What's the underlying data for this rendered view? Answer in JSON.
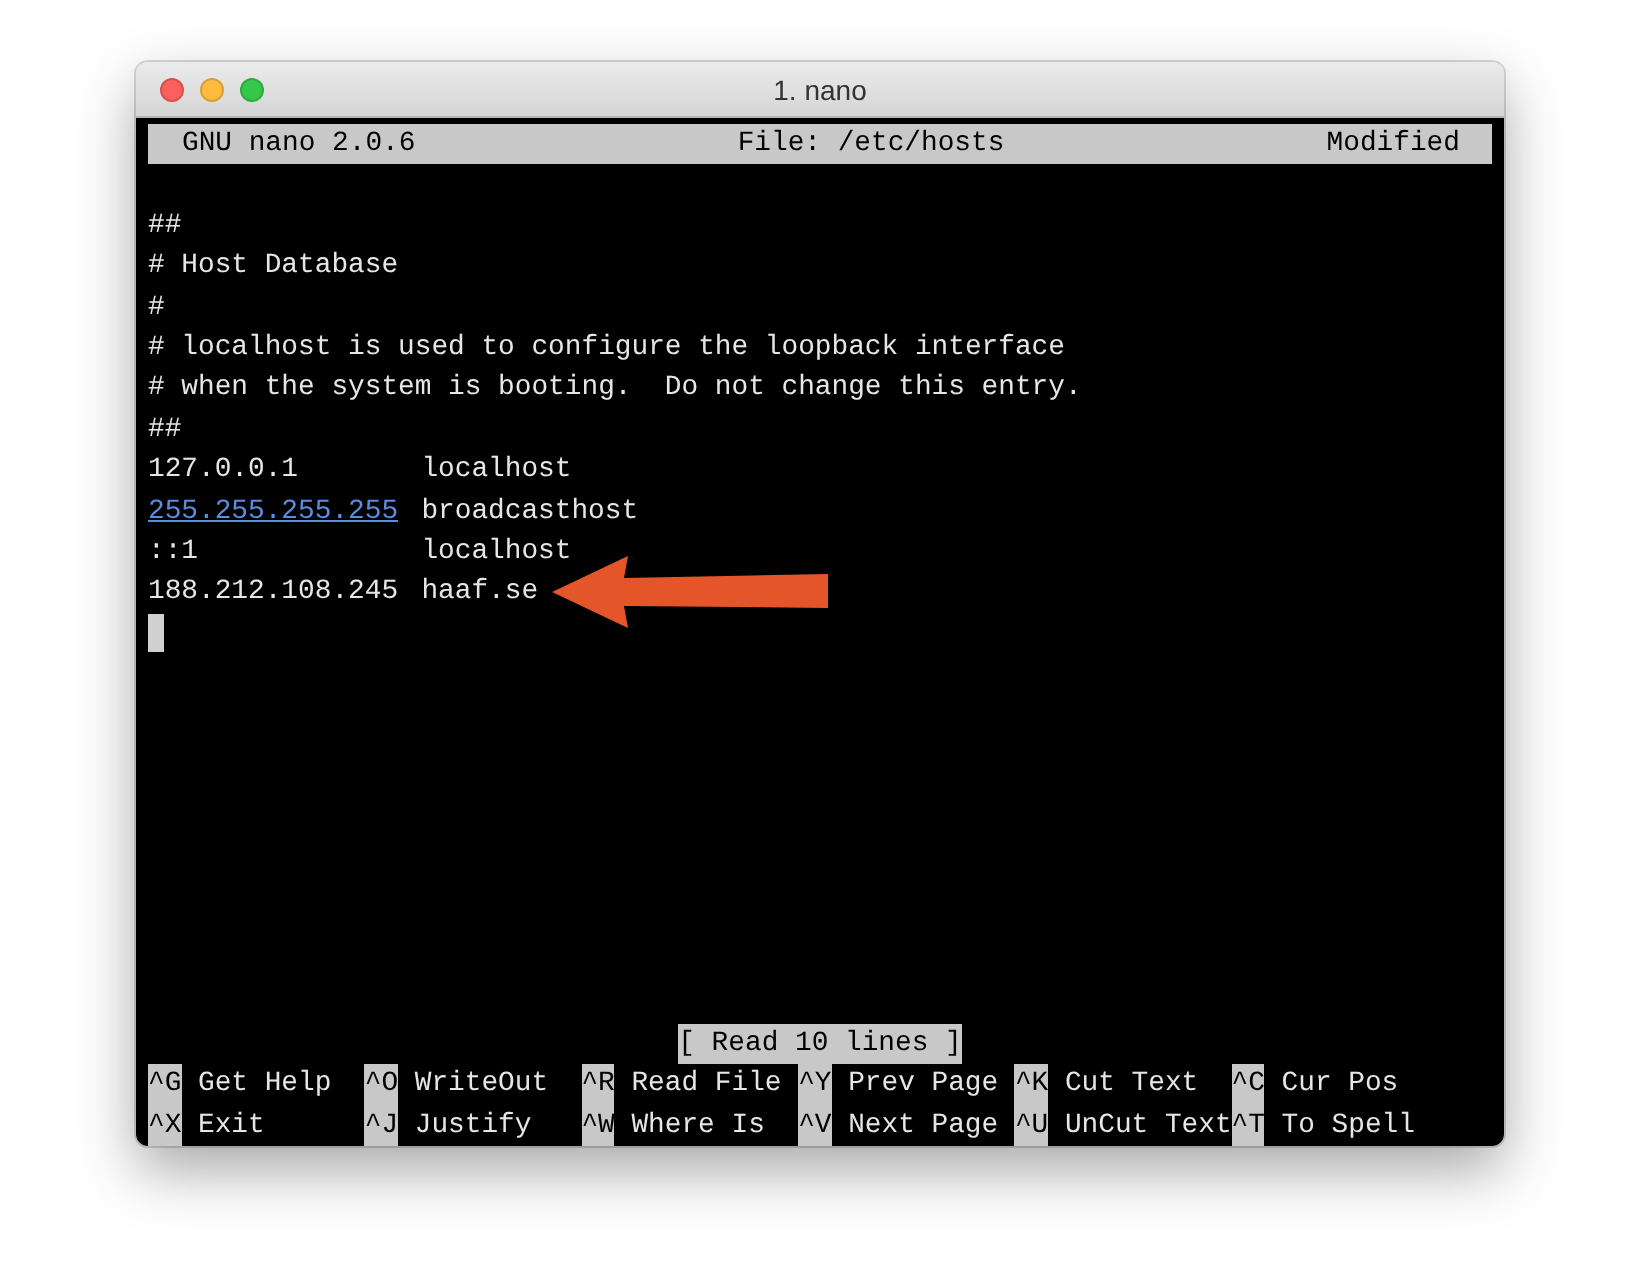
{
  "window": {
    "title": "1. nano"
  },
  "header": {
    "app": "GNU nano 2.0.6",
    "file": "File: /etc/hosts",
    "state": "Modified"
  },
  "lines": [
    {
      "kind": "blank"
    },
    {
      "kind": "comment",
      "text": "##"
    },
    {
      "kind": "comment",
      "text": "# Host Database"
    },
    {
      "kind": "comment",
      "text": "#"
    },
    {
      "kind": "comment",
      "text": "# localhost is used to configure the loopback interface"
    },
    {
      "kind": "comment",
      "text": "# when the system is booting.  Do not change this entry."
    },
    {
      "kind": "comment",
      "text": "##"
    },
    {
      "kind": "entry",
      "address": "127.0.0.1",
      "host": "localhost",
      "link": false
    },
    {
      "kind": "entry",
      "address": "255.255.255.255",
      "host": "broadcasthost",
      "link": true
    },
    {
      "kind": "entry",
      "address": "::1",
      "host": "localhost",
      "link": false
    },
    {
      "kind": "entry",
      "address": "188.212.108.245",
      "host": "haaf.se",
      "link": false,
      "arrow": true
    },
    {
      "kind": "cursor"
    }
  ],
  "status": "[ Read 10 lines ]",
  "shortcuts": [
    [
      {
        "key": "^G",
        "label": "Get Help"
      },
      {
        "key": "^O",
        "label": "WriteOut"
      },
      {
        "key": "^R",
        "label": "Read File"
      },
      {
        "key": "^Y",
        "label": "Prev Page"
      },
      {
        "key": "^K",
        "label": "Cut Text"
      },
      {
        "key": "^C",
        "label": "Cur Pos"
      }
    ],
    [
      {
        "key": "^X",
        "label": "Exit"
      },
      {
        "key": "^J",
        "label": "Justify"
      },
      {
        "key": "^W",
        "label": "Where Is"
      },
      {
        "key": "^V",
        "label": "Next Page"
      },
      {
        "key": "^U",
        "label": "UnCut Text"
      },
      {
        "key": "^T",
        "label": "To Spell"
      }
    ]
  ]
}
